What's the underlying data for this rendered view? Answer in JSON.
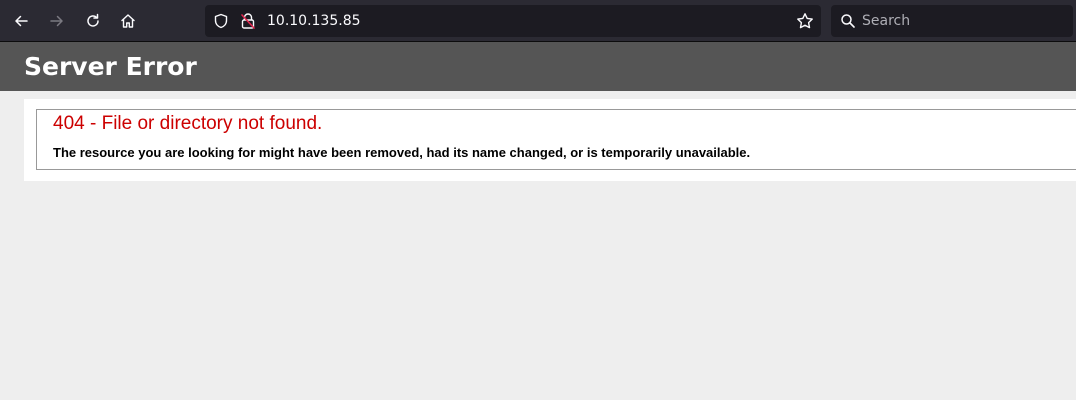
{
  "browser": {
    "url": "10.10.135.85",
    "search_placeholder": "Search",
    "icons": {
      "back": "arrow-left-icon",
      "forward": "arrow-right-icon",
      "reload": "reload-icon",
      "home": "home-icon",
      "tracking_protection": "shield-icon",
      "insecure_connection": "lock-insecure-icon",
      "bookmark": "star-icon",
      "search": "magnifier-icon"
    },
    "forward_enabled": false
  },
  "page": {
    "header_title": "Server Error",
    "error_title": "404 - File or directory not found.",
    "error_message": "The resource you are looking for might have been removed, had its name changed, or is temporarily unavailable."
  },
  "colors": {
    "toolbar_bg": "#2b2a33",
    "field_bg": "#1c1b22",
    "header_bg": "#555555",
    "error_red": "#cc0000",
    "page_bg": "#eeeeee"
  }
}
